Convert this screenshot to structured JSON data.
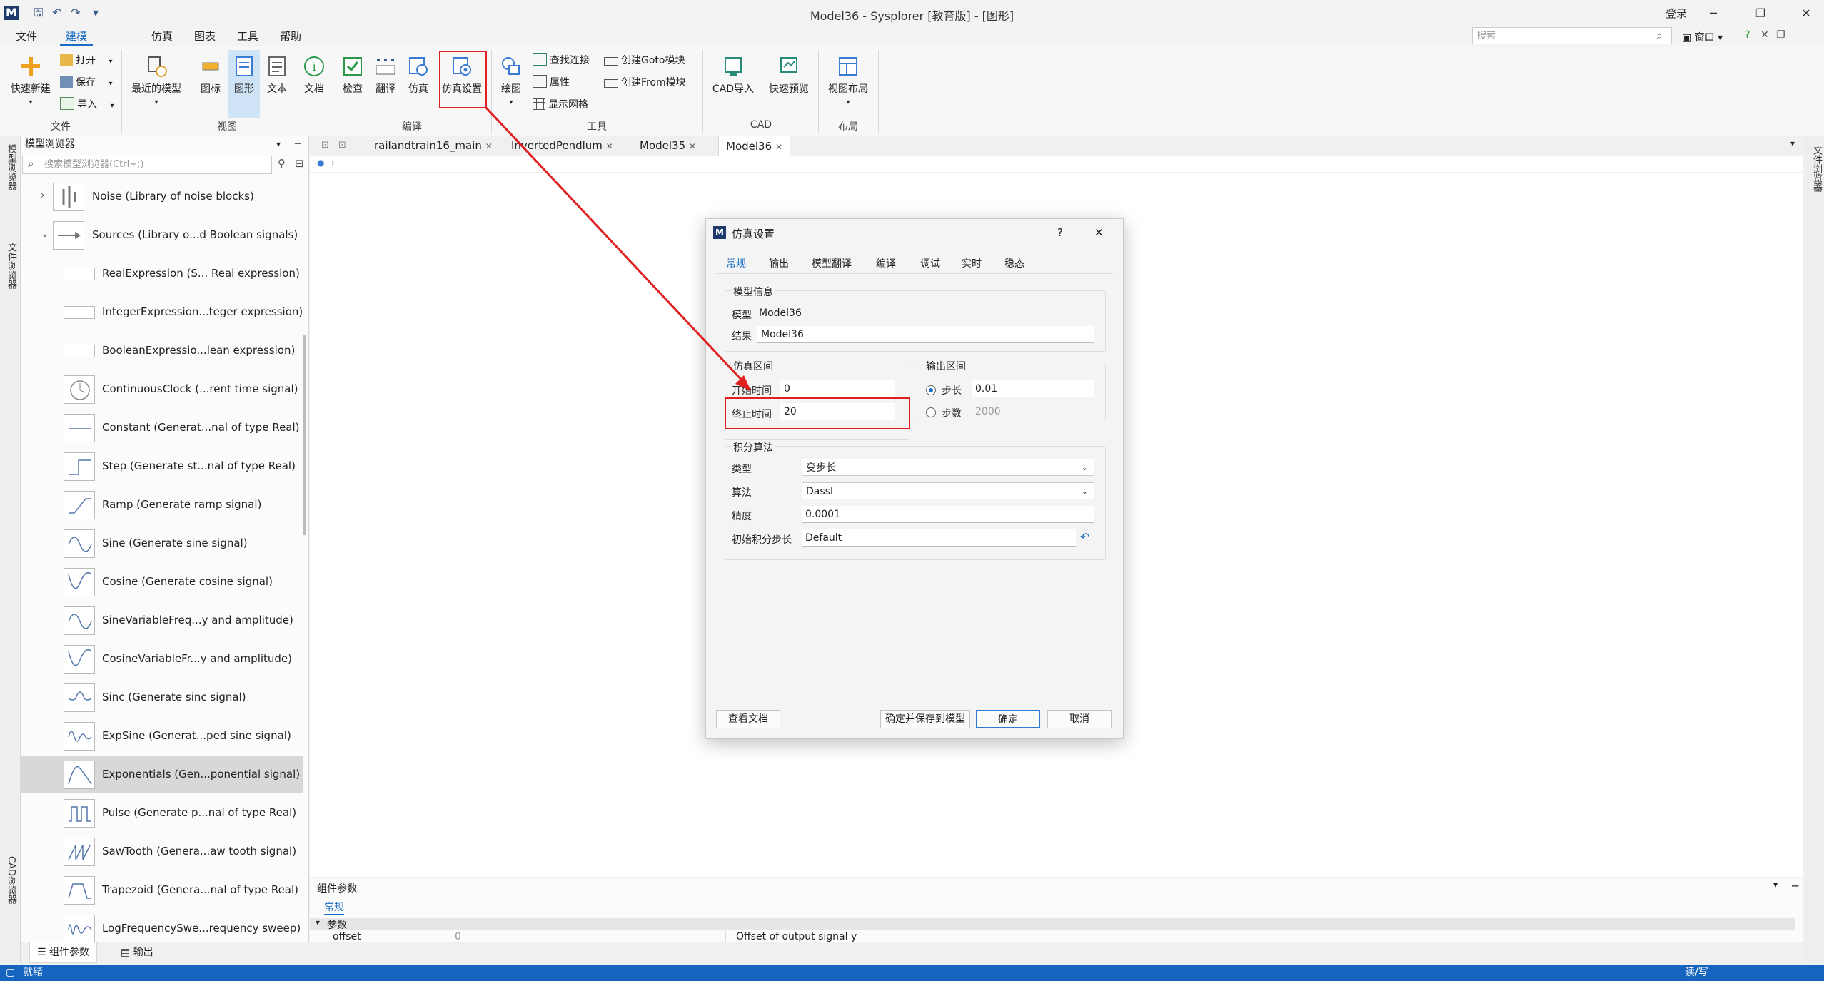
{
  "window": {
    "title": "Model36 - Sysplorer [教育版] - [图形]",
    "login": "登录",
    "minimize": "─",
    "restore": "❐",
    "close": "✕",
    "search_placeholder": "搜索",
    "window_menu": "窗口"
  },
  "menu": [
    "文件",
    "建模",
    "仿真",
    "图表",
    "工具",
    "帮助"
  ],
  "menu_active": "建模",
  "ribbon": {
    "file_group": {
      "label": "文件",
      "new": "快速新建",
      "open": "打开",
      "save": "保存",
      "import": "导入"
    },
    "view_group": {
      "label": "视图",
      "recent": "最近的模型",
      "icon": "图标",
      "graphic": "图形",
      "text": "文本",
      "doc": "文档"
    },
    "compile_group": {
      "label": "编译",
      "check": "检查",
      "translate": "翻译",
      "simulate": "仿真",
      "sim_settings": "仿真设置"
    },
    "tools_group": {
      "label": "工具",
      "plot": "绘图",
      "find_conn": "查找连接",
      "props": "属性",
      "show_grid": "显示网格",
      "create_goto": "创建Goto模块",
      "create_from": "创建From模块"
    },
    "cad_group": {
      "label": "CAD",
      "cad_import": "CAD导入",
      "quick_preview": "快速预览"
    },
    "layout_group": {
      "label": "布局",
      "view_layout": "视图布局"
    }
  },
  "side_strips": {
    "model_browser": "模型浏览器",
    "file_browser": "文件浏览器",
    "cad_browser": "CAD浏览器",
    "right_file_browser": "文件浏览器"
  },
  "browser": {
    "title": "模型浏览器",
    "search_placeholder": "搜索模型浏览器(Ctrl+;)",
    "items": [
      {
        "label": "Noise (Library of noise blocks)",
        "kind": "lib",
        "expanded": false
      },
      {
        "label": "Sources (Library o...d Boolean signals)",
        "kind": "lib",
        "expanded": true
      },
      {
        "label": "RealExpression (S... Real expression)",
        "kind": "flat"
      },
      {
        "label": "IntegerExpression...teger expression)",
        "kind": "flat"
      },
      {
        "label": "BooleanExpressio...lean expression)",
        "kind": "flat"
      },
      {
        "label": "ContinuousClock (...rent time signal)",
        "kind": "clock"
      },
      {
        "label": "Constant (Generat...nal of type Real)",
        "kind": "const"
      },
      {
        "label": "Step (Generate st...nal of type Real)",
        "kind": "step"
      },
      {
        "label": "Ramp (Generate ramp signal)",
        "kind": "ramp"
      },
      {
        "label": "Sine (Generate sine signal)",
        "kind": "sine"
      },
      {
        "label": "Cosine (Generate cosine signal)",
        "kind": "cos"
      },
      {
        "label": "SineVariableFreq...y and amplitude)",
        "kind": "sine"
      },
      {
        "label": "CosineVariableFr...y and amplitude)",
        "kind": "cos"
      },
      {
        "label": "Sinc (Generate sinc signal)",
        "kind": "sinc"
      },
      {
        "label": "ExpSine (Generat...ped sine signal)",
        "kind": "expsine"
      },
      {
        "label": "Exponentials (Gen...ponential signal)",
        "kind": "exp",
        "selected": true
      },
      {
        "label": "Pulse (Generate p...nal of type Real)",
        "kind": "pulse"
      },
      {
        "label": "SawTooth (Genera...aw tooth signal)",
        "kind": "saw"
      },
      {
        "label": "Trapezoid (Genera...nal of type Real)",
        "kind": "trap"
      },
      {
        "label": "LogFrequencySwe...requency sweep)",
        "kind": "log"
      }
    ]
  },
  "doc_tabs": [
    {
      "label": "railandtrain16_main",
      "active": false
    },
    {
      "label": "InvertedPendlum",
      "active": false
    },
    {
      "label": "Model35",
      "active": false
    },
    {
      "label": "Model36",
      "active": true
    }
  ],
  "params_panel": {
    "title": "组件参数",
    "tab": "常规",
    "section": "参数",
    "row": {
      "name": "offset",
      "value": "0",
      "desc": "Offset of output signal y"
    }
  },
  "bottom_tabs": [
    "组件参数",
    "输出"
  ],
  "status": {
    "left": "就绪",
    "right": "读/写"
  },
  "dialog": {
    "title": "仿真设置",
    "help": "?",
    "close": "✕",
    "tabs": [
      "常规",
      "输出",
      "模型翻译",
      "编译",
      "调试",
      "实时",
      "稳态"
    ],
    "model_info": {
      "legend": "模型信息",
      "model_label": "模型",
      "model_value": "Model36",
      "result_label": "结果",
      "result_value": "Model36"
    },
    "sim_interval": {
      "legend": "仿真区间",
      "start_label": "开始时间",
      "start_value": "0",
      "stop_label": "终止时间",
      "stop_value": "20"
    },
    "output_interval": {
      "legend": "输出区间",
      "step_label": "步长",
      "step_value": "0.01",
      "count_label": "步数",
      "count_value": "2000"
    },
    "integration": {
      "legend": "积分算法",
      "type_label": "类型",
      "type_value": "变步长",
      "algo_label": "算法",
      "algo_value": "Dassl",
      "tol_label": "精度",
      "tol_value": "0.0001",
      "init_label": "初始积分步长",
      "init_value": "Default"
    },
    "buttons": {
      "doc": "查看文档",
      "save_to_model": "确定并保存到模型",
      "ok": "确定",
      "cancel": "取消"
    }
  },
  "accent_color": "#1a6fc4",
  "highlight_color": "#e02020"
}
